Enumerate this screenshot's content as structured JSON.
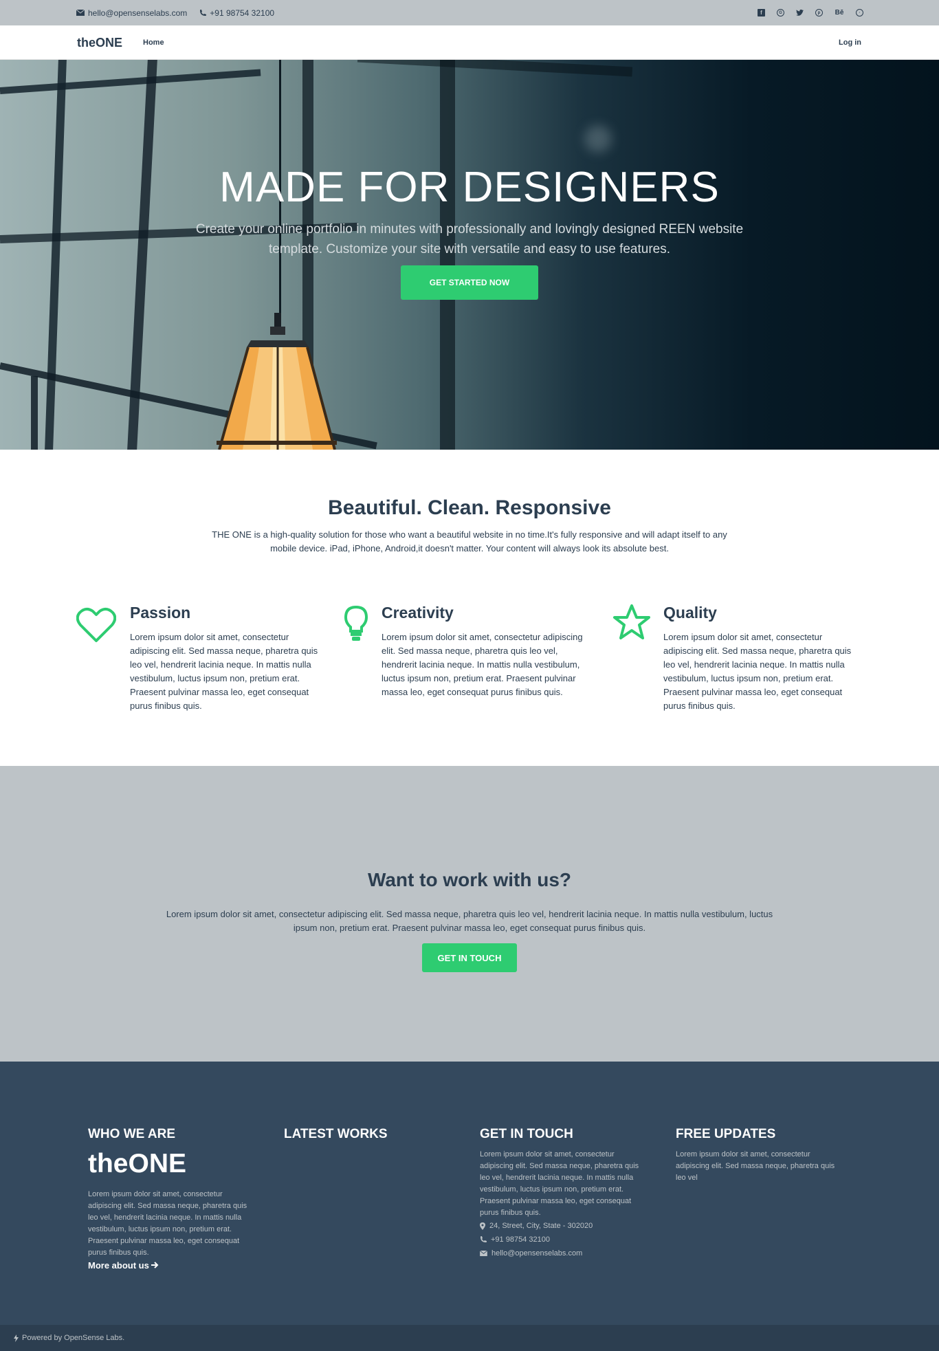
{
  "topbar": {
    "email": "hello@opensenselabs.com",
    "phone": "+91 98754 32100",
    "social": [
      "facebook-icon",
      "google-plus-icon",
      "twitter-icon",
      "pinterest-icon",
      "behance-icon",
      "dribbble-icon"
    ],
    "behance_label": "Bē"
  },
  "nav": {
    "brand": "theONE",
    "home": "Home",
    "login": "Log in"
  },
  "hero": {
    "title": "MADE FOR DESIGNERS",
    "subtitle": "Create your online portfolio in minutes with professionally and lovingly designed REEN website template. Customize your site with versatile and easy to use features.",
    "button": "GET STARTED NOW"
  },
  "intro": {
    "title": "Beautiful. Clean. Responsive",
    "text": "THE ONE is a high-quality solution for those who want a beautiful website in no time.It's fully responsive and will adapt itself to any mobile device. iPad, iPhone, Android,it doesn't matter. Your content will always look its absolute best."
  },
  "features": [
    {
      "icon": "heart-icon",
      "title": "Passion",
      "text": "Lorem ipsum dolor sit amet, consectetur adipiscing elit. Sed massa neque, pharetra quis leo vel, hendrerit lacinia neque. In mattis nulla vestibulum, luctus ipsum non, pretium erat. Praesent pulvinar massa leo, eget consequat purus finibus quis."
    },
    {
      "icon": "lightbulb-icon",
      "title": "Creativity",
      "text": "Lorem ipsum dolor sit amet, consectetur adipiscing elit. Sed massa neque, pharetra quis leo vel, hendrerit lacinia neque. In mattis nulla vestibulum, luctus ipsum non, pretium erat. Praesent pulvinar massa leo, eget consequat purus finibus quis."
    },
    {
      "icon": "star-icon",
      "title": "Quality",
      "text": "Lorem ipsum dolor sit amet, consectetur adipiscing elit. Sed massa neque, pharetra quis leo vel, hendrerit lacinia neque. In mattis nulla vestibulum, luctus ipsum non, pretium erat. Praesent pulvinar massa leo, eget consequat purus finibus quis."
    }
  ],
  "work": {
    "title": "Want to work with us?",
    "text": "Lorem ipsum dolor sit amet, consectetur adipiscing elit. Sed massa neque, pharetra quis leo vel, hendrerit lacinia neque. In mattis nulla vestibulum, luctus ipsum non, pretium erat. Praesent pulvinar massa leo, eget consequat purus finibus quis.",
    "button": "GET IN TOUCH"
  },
  "footer": {
    "who": {
      "heading": "WHO WE ARE",
      "logo": "theONE",
      "text": "Lorem ipsum dolor sit amet, consectetur adipiscing elit. Sed massa neque, pharetra quis leo vel, hendrerit lacinia neque. In mattis nulla vestibulum, luctus ipsum non, pretium erat. Praesent pulvinar massa leo, eget consequat purus finibus quis.",
      "more": "More about us"
    },
    "works": {
      "heading": "LATEST WORKS"
    },
    "touch": {
      "heading": "GET IN TOUCH",
      "text": "Lorem ipsum dolor sit amet, consectetur adipiscing elit. Sed massa neque, pharetra quis leo vel, hendrerit lacinia neque. In mattis nulla vestibulum, luctus ipsum non, pretium erat. Praesent pulvinar massa leo, eget consequat purus finibus quis.",
      "address": "24, Street, City, State - 302020",
      "phone": "+91 98754 32100",
      "email": "hello@opensenselabs.com"
    },
    "updates": {
      "heading": "FREE UPDATES",
      "text": "Lorem ipsum dolor sit amet, consectetur adipiscing elit. Sed massa neque, pharetra quis leo vel"
    }
  },
  "subfooter": {
    "text": "Powered by OpenSense Labs."
  },
  "colors": {
    "accent": "#2ecc71",
    "dark": "#2c3e50",
    "footer": "#34495e",
    "gray": "#bdc3c7"
  }
}
